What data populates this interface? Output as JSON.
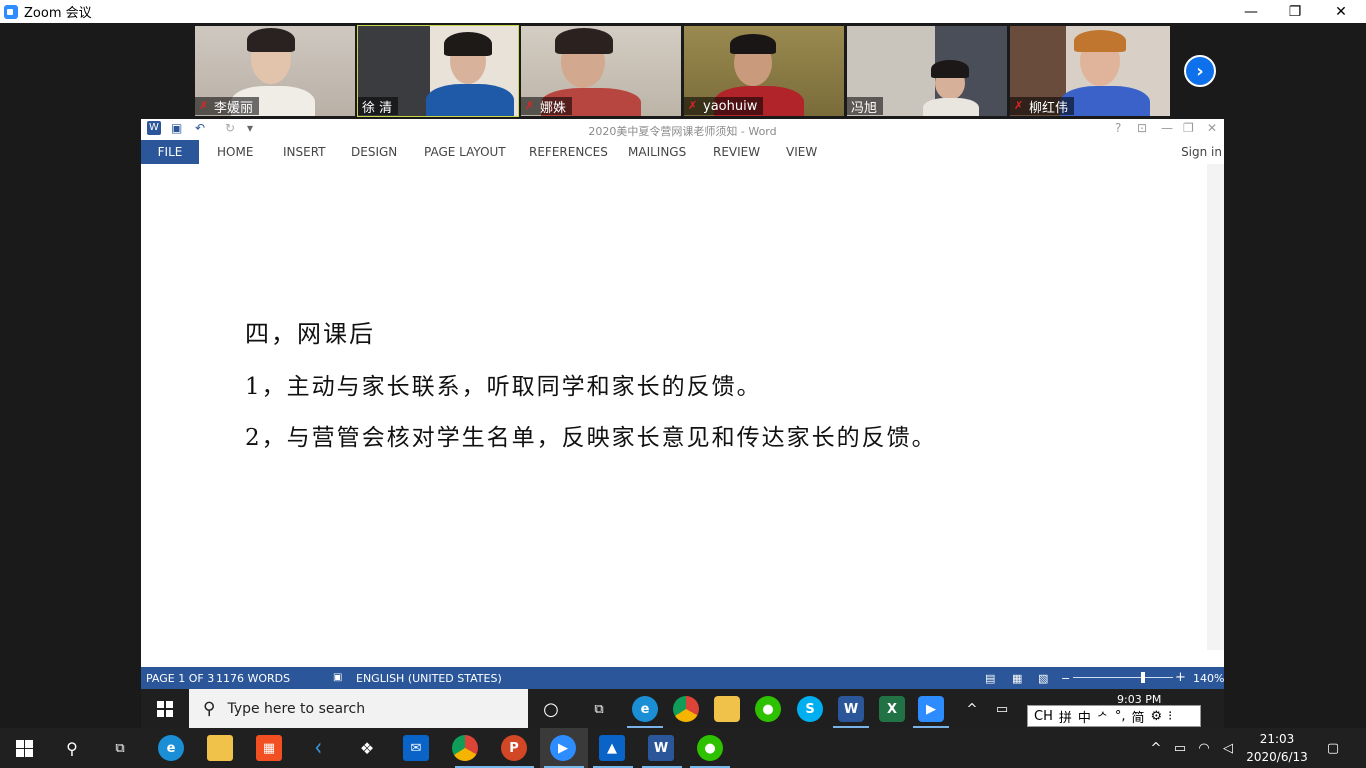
{
  "zoom": {
    "title": "Zoom 会议",
    "window_controls": {
      "minimize": "—",
      "restore": "❐",
      "close": "✕"
    }
  },
  "participants": [
    {
      "name": "李媛丽",
      "muted": true,
      "active": false
    },
    {
      "name": "徐 清",
      "muted": false,
      "active": true
    },
    {
      "name": "娜姝",
      "muted": true,
      "active": false
    },
    {
      "name": "yaohuiw",
      "muted": true,
      "active": false
    },
    {
      "name": "冯旭",
      "muted": false,
      "active": false
    },
    {
      "name": "柳红伟",
      "muted": true,
      "active": false
    }
  ],
  "gallery_next": "›",
  "word": {
    "title": "2020美中夏令营网课老师须知 - Word",
    "controls": {
      "help": "?",
      "ribbon_display": "⊡",
      "minimize": "—",
      "restore": "❐",
      "close": "✕"
    },
    "tabs": [
      "FILE",
      "HOME",
      "INSERT",
      "DESIGN",
      "PAGE LAYOUT",
      "REFERENCES",
      "MAILINGS",
      "REVIEW",
      "VIEW"
    ],
    "sign_in": "Sign in",
    "document_lines": [
      "四，网课后",
      "1，主动与家长联系，听取同学和家长的反馈。",
      "2，与营管会核对学生名单，反映家长意见和传达家长的反馈。"
    ],
    "status": {
      "page": "PAGE 1 OF 3",
      "words": "1176 WORDS",
      "language": "ENGLISH (UNITED STATES)",
      "zoom_minus": "−",
      "zoom_plus": "+",
      "zoom": "140%",
      "zoom_level": 0.7
    }
  },
  "inner_taskbar": {
    "search_placeholder": "Type here to search",
    "clock": "9:03 PM",
    "ime": [
      "CH",
      "拼",
      "中",
      "ᄼ",
      "°,",
      "简",
      "⚙",
      "⁝"
    ]
  },
  "taskbar": {
    "time": "21:03",
    "date": "2020/6/13"
  },
  "colors": {
    "word_blue": "#2b579a",
    "zoom_blue": "#0e71eb",
    "active_speaker": "#c8d84a",
    "muted_red": "#e02424"
  }
}
